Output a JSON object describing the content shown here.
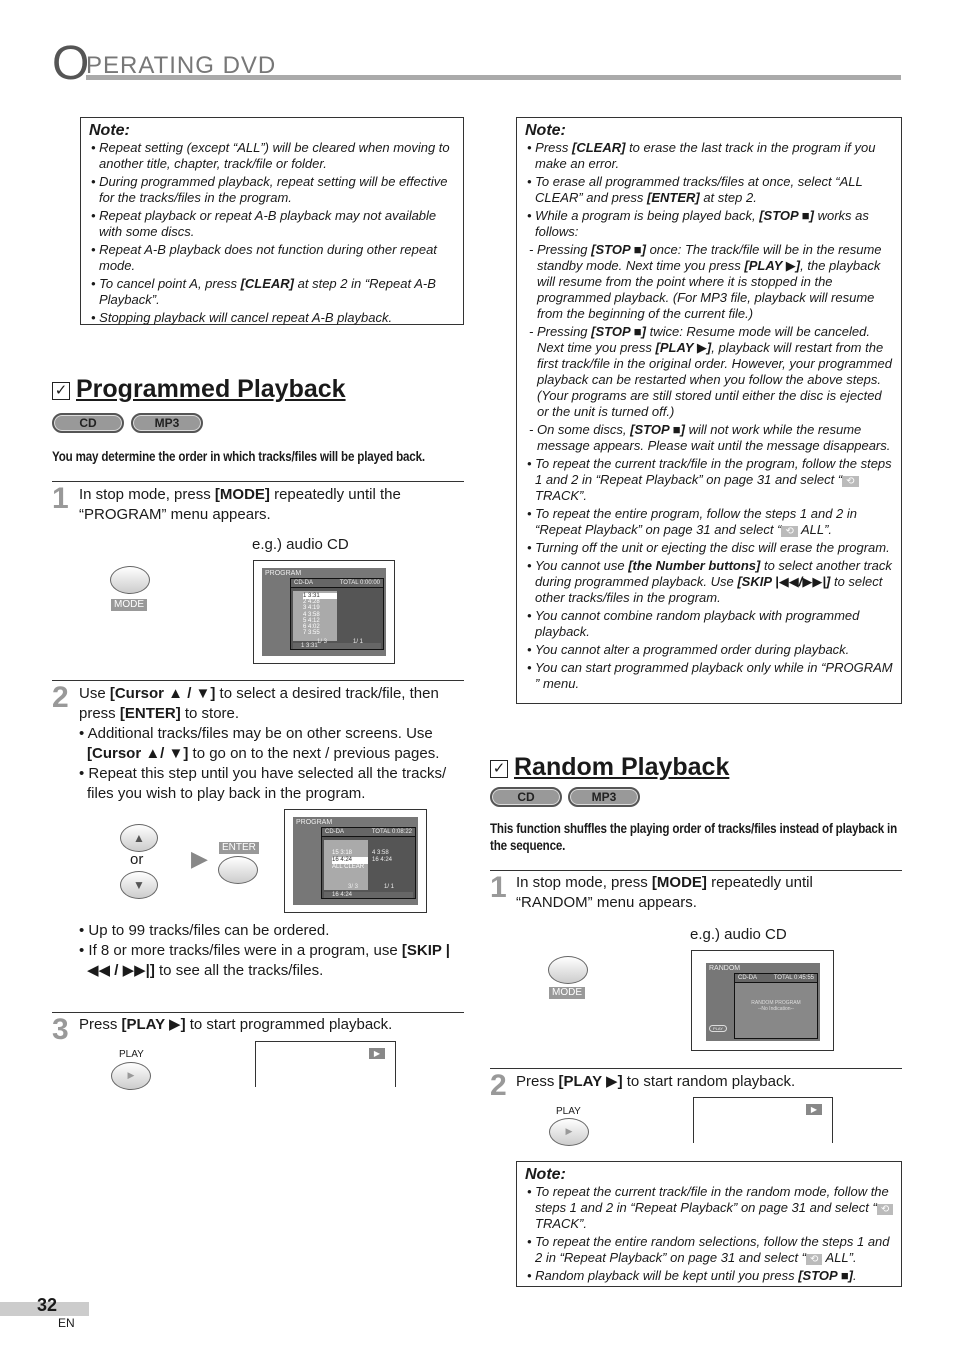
{
  "header": {
    "initial": "O",
    "rest": "PERATING  DVD"
  },
  "left_note": {
    "title": "Note:",
    "items": [
      "Repeat setting (except “ALL”) will be cleared when moving to another title, chapter, track/file or folder.",
      "During programmed playback, repeat setting will be effective for the tracks/files in the program.",
      "Repeat playback or repeat A-B playback may not available with some discs.",
      "Repeat A-B playback does not function during other repeat mode.",
      "To cancel point A, press [CLEAR] at step 2 in “Repeat A-B Playback”.",
      "Stopping playback will cancel repeat A-B playback."
    ]
  },
  "programmed": {
    "title": "Programmed Playback",
    "check": "☑",
    "pills": [
      "CD",
      "MP3"
    ],
    "lead": "You may determine the order in which tracks/files will be played back.",
    "step1": {
      "num": "1",
      "text": "In stop mode, press [MODE] repeatedly until the “PROGRAM” menu appears.",
      "eg": "e.g.) audio CD",
      "button": "MODE",
      "screen": {
        "title": "PROGRAM",
        "disc": "CD-DA",
        "total": "TOTAL   0:00:00",
        "tracks": [
          "1  3:31",
          "2  4:28",
          "3  4:19",
          "4  3:58",
          "5  4:12",
          "6  4:02",
          "7  3:55"
        ],
        "page_left": "1/  3",
        "page_right": "1/  1",
        "status": "1  3:31",
        "keys": [
          "ENTER",
          "PLAY",
          "CLEAR"
        ]
      }
    },
    "step2": {
      "num": "2",
      "lines": [
        "Use [Cursor ▲ / ▼] to select a desired track/file, then press [ENTER] to store.",
        "• Additional tracks/files may be on other screens. Use [Cursor ▲/ ▼] to go on to the next / previous pages.",
        "• Repeat this step until you have selected all the tracks/ files you wish to play back in the program."
      ],
      "or": "or",
      "enter": "ENTER",
      "screen": {
        "title": "PROGRAM",
        "disc": "CD-DA",
        "total": "TOTAL   0:08:22",
        "tracks": [
          "15  3:18",
          "16  4:24"
        ],
        "clear": "ALL CLEAR",
        "prog": [
          "4    3:58",
          "16    4:24"
        ],
        "page_left": "3/  3",
        "page_right": "1/  1",
        "status": "16  4:24"
      },
      "bullets": [
        "• Up to 99 tracks/files can be ordered.",
        "• If 8 or more tracks/files were in a program, use [SKIP |◀◀ / ▶▶|] to see all the tracks/files."
      ]
    },
    "step3": {
      "num": "3",
      "text": "Press [PLAY ▶] to start programmed playback.",
      "button": "PLAY",
      "indicator": "▶"
    }
  },
  "right_note": {
    "title": "Note:",
    "items": [
      {
        "t": "Press [CLEAR] to erase the last track in the program if you make an error."
      },
      {
        "t": "To erase all programmed tracks/files at once, select “ALL CLEAR” and press [ENTER] at step 2."
      },
      {
        "t": "While a program is being played back, [STOP ■] works as follows:"
      },
      {
        "t": "Pressing [STOP ■] once: The track/file will be in the resume standby mode.  Next time you press [PLAY ▶], the playback will resume from the point where it is stopped in the programmed playback. (For MP3 file, playback will resume from the beginning of the current file.)",
        "sub": true
      },
      {
        "t": "Pressing [STOP ■] twice: Resume mode will be canceled.  Next time you press [PLAY ▶], playback will restart from the first track/file in the original order. However, your programmed playback can be restarted when you follow the above steps. (Your programs are still stored until either the disc is ejected or the unit is turned off.)",
        "sub": true
      },
      {
        "t": "On some discs, [STOP ■] will not work while the resume message appears. Please wait until the message disappears.",
        "sub": true
      },
      {
        "t": "To repeat the current track/file in the program, follow the steps 1 and 2 in “Repeat Playback” on page 31 and select “⟲ TRACK”."
      },
      {
        "t": "To repeat the entire program, follow the steps 1 and 2 in “Repeat Playback” on page 31 and select “⟲ ALL”."
      },
      {
        "t": "Turning off the unit or ejecting the disc will erase the program."
      },
      {
        "t": "You cannot use [the Number buttons] to select another track during programmed playback.  Use [SKIP |◀◀/▶▶|] to select other tracks/files in the program."
      },
      {
        "t": "You cannot combine random playback with programmed playback."
      },
      {
        "t": "You cannot alter a programmed order during playback."
      },
      {
        "t": "You can start programmed playback only while in “PROGRAM ” menu."
      }
    ]
  },
  "random": {
    "title": "Random Playback",
    "check": "☑",
    "pills": [
      "CD",
      "MP3"
    ],
    "lead": "This function shuffles the playing order of tracks/files instead of playback in the sequence.",
    "step1": {
      "num": "1",
      "text": "In stop mode, press [MODE] repeatedly until “RANDOM” menu appears.",
      "eg": "e.g.) audio CD",
      "button": "MODE",
      "screen": {
        "title": "RANDOM",
        "disc": "CD-DA",
        "total": "TOTAL 0:45:55",
        "msg1": "RANDOM PROGRAM",
        "msg2": "--No Indication--",
        "key": "PLAY"
      }
    },
    "step2": {
      "num": "2",
      "text": "Press [PLAY ▶] to start random playback.",
      "button": "PLAY",
      "indicator": "▶"
    },
    "note": {
      "title": "Note:",
      "items": [
        "To repeat the current track/file in the random mode, follow the steps 1 and 2 in “Repeat Playback” on page 31 and select “⟲ TRACK”.",
        "To repeat the entire random selections, follow the steps 1 and 2 in “Repeat Playback” on page 31 and select “⟲ ALL”.",
        "Random playback will be kept until you press [STOP ■]."
      ]
    }
  },
  "footer": {
    "page": "32",
    "lang": "EN"
  }
}
